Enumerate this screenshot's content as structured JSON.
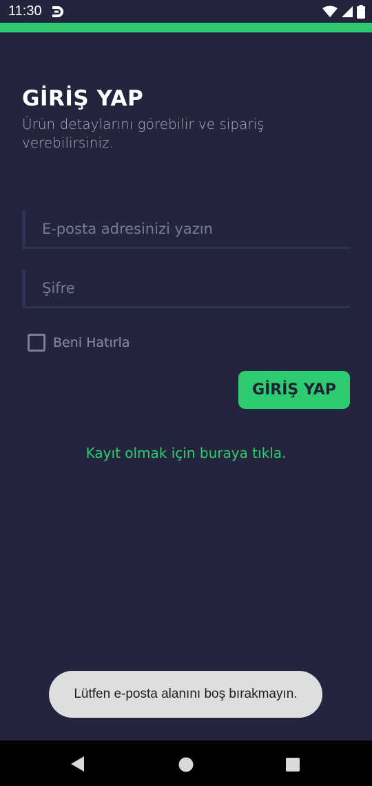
{
  "status_bar": {
    "time": "11:30",
    "icons": [
      "app-d-logo-icon",
      "wifi-icon",
      "cell-signal-icon",
      "battery-icon"
    ]
  },
  "colors": {
    "background": "#22253b",
    "accent": "#2ecc71",
    "toast_background": "#dddee0",
    "nav_bar": "#000000"
  },
  "login": {
    "title": "GİRİŞ YAP",
    "subtitle": "Ürün detaylarını görebilir ve sipariş verebilirsiniz.",
    "email_placeholder": "E-posta adresinizi yazın",
    "email_value": "",
    "password_placeholder": "Şifre",
    "password_value": "",
    "remember_label": "Beni Hatırla",
    "remember_checked": false,
    "login_button": "GİRİŞ YAP",
    "register_link": "Kayıt olmak için buraya tıkla."
  },
  "toast": {
    "message": "Lütfen e-posta alanını boş bırakmayın."
  },
  "nav_bar": {
    "icons": [
      "back-icon",
      "home-icon",
      "recents-icon"
    ]
  }
}
